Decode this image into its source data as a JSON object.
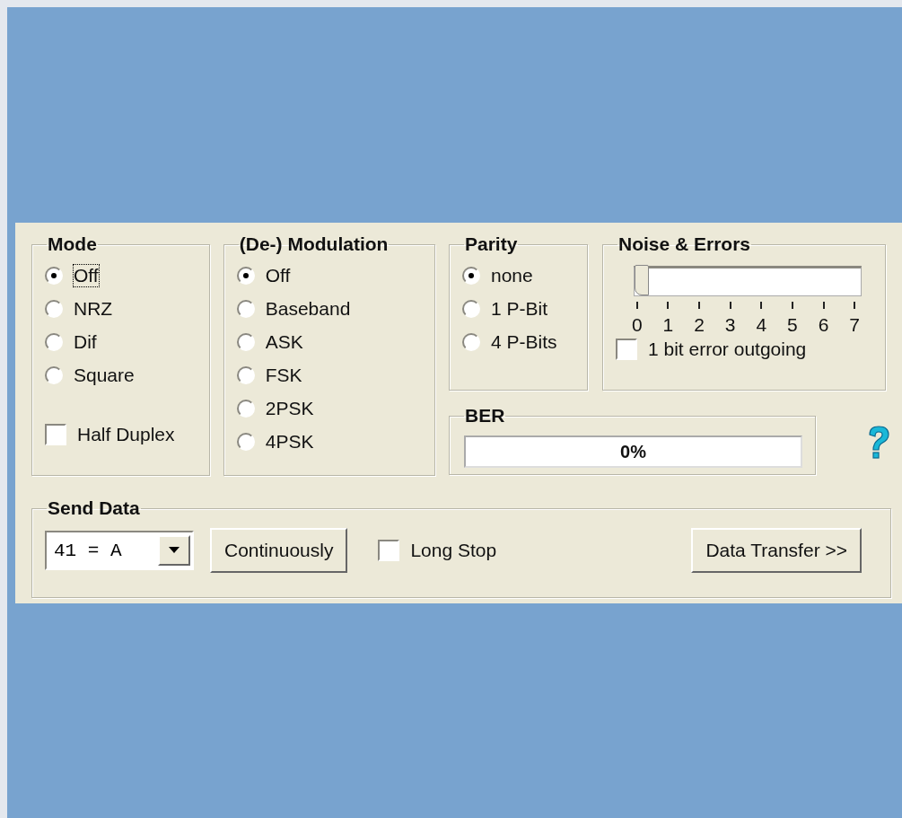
{
  "mode": {
    "title": "Mode",
    "options": [
      {
        "label": "Off",
        "selected": true,
        "focused": true
      },
      {
        "label": "NRZ",
        "selected": false,
        "focused": false
      },
      {
        "label": "Dif",
        "selected": false,
        "focused": false
      },
      {
        "label": "Square",
        "selected": false,
        "focused": false
      }
    ],
    "half_duplex": {
      "label": "Half Duplex",
      "checked": false
    }
  },
  "modulation": {
    "title": "(De-) Modulation",
    "options": [
      {
        "label": "Off",
        "selected": true
      },
      {
        "label": "Baseband",
        "selected": false
      },
      {
        "label": "ASK",
        "selected": false
      },
      {
        "label": "FSK",
        "selected": false
      },
      {
        "label": "2PSK",
        "selected": false
      },
      {
        "label": "4PSK",
        "selected": false
      }
    ]
  },
  "parity": {
    "title": "Parity",
    "options": [
      {
        "label": "none",
        "selected": true
      },
      {
        "label": "1 P-Bit",
        "selected": false
      },
      {
        "label": "4 P-Bits",
        "selected": false
      }
    ]
  },
  "noise": {
    "title": "Noise & Errors",
    "slider": {
      "level": 0,
      "ticks": [
        "0",
        "1",
        "2",
        "3",
        "4",
        "5",
        "6",
        "7"
      ]
    },
    "error_checkbox": {
      "label": "1 bit error outgoing",
      "checked": false
    }
  },
  "ber": {
    "title": "BER",
    "level": 0,
    "reading": "0%"
  },
  "send_data": {
    "title": "Send Data",
    "dropdown_value": "41 = A",
    "continuous_button": "Continuously",
    "long_stop": {
      "label": "Long Stop",
      "checked": false
    },
    "transfer_button": "Data Transfer >>"
  }
}
